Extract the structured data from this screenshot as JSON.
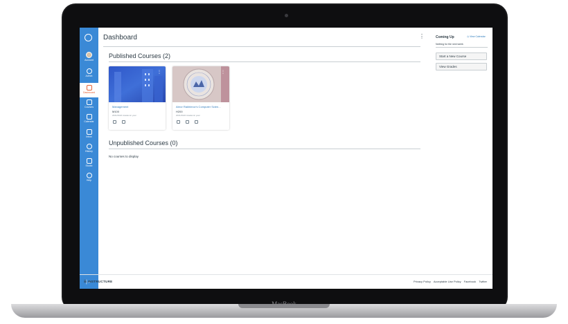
{
  "device": {
    "brand": "MacBook"
  },
  "global_nav": {
    "items": [
      {
        "label": "Account",
        "icon": "avatar"
      },
      {
        "label": "Admin",
        "icon": "shield-icon"
      },
      {
        "label": "Dashboard",
        "icon": "dashboard-icon",
        "active": true
      },
      {
        "label": "Courses",
        "icon": "book-icon"
      },
      {
        "label": "Calendar",
        "icon": "calendar-icon"
      },
      {
        "label": "Inbox",
        "icon": "inbox-icon"
      },
      {
        "label": "History",
        "icon": "clock-icon"
      },
      {
        "label": "Studio",
        "icon": "monitor-icon"
      },
      {
        "label": "Help",
        "icon": "help-icon"
      }
    ],
    "collapse_icon": "collapse-arrow-icon",
    "accent": "#3a89d6",
    "active_color": "#e66135"
  },
  "header": {
    "title": "Dashboard",
    "menu_icon": "kebab-icon"
  },
  "published": {
    "title": "Published Courses (2)",
    "cards": [
      {
        "title": "Management",
        "code": "M100",
        "term": "2021/2022 Academic year",
        "icons": [
          "announcements-icon",
          "files-icon"
        ]
      },
      {
        "title": "Abror Rakhimov's Computer Scien...",
        "code": "H200",
        "term": "2021/2022 Academic year",
        "icons": [
          "assignments-icon",
          "announcements-icon",
          "files-icon"
        ]
      }
    ]
  },
  "unpublished": {
    "title": "Unpublished Courses (0)",
    "empty": "No courses to display"
  },
  "sidebar": {
    "coming_up": "Coming Up",
    "view_calendar": "View Calendar",
    "nothing": "Nothing for the next week",
    "buttons": [
      "Start a New Course",
      "View Grades"
    ]
  },
  "footer": {
    "logo": "INSTRUCTURE",
    "links": [
      "Privacy Policy",
      "Acceptable Use Policy",
      "Facebook",
      "Twitter"
    ]
  }
}
